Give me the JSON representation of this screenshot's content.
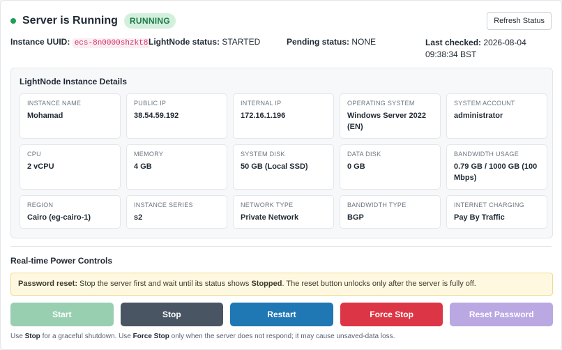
{
  "header": {
    "title": "Server is Running",
    "badge": "RUNNING",
    "refresh_label": "Refresh Status"
  },
  "info": {
    "uuid_label": "Instance UUID:",
    "uuid_value": "ecs-8n0000shzkt8",
    "lightnode_label": "LightNode status:",
    "lightnode_value": "STARTED",
    "pending_label": "Pending status:",
    "pending_value": "NONE",
    "checked_label": "Last checked:",
    "checked_value": "2026-08-04 09:38:34 BST"
  },
  "details": {
    "title": "LightNode Instance Details",
    "tiles": [
      {
        "label": "INSTANCE NAME",
        "value": "Mohamad"
      },
      {
        "label": "PUBLIC IP",
        "value": "38.54.59.192"
      },
      {
        "label": "INTERNAL IP",
        "value": "172.16.1.196"
      },
      {
        "label": "OPERATING SYSTEM",
        "value": "Windows Server 2022 (EN)"
      },
      {
        "label": "SYSTEM ACCOUNT",
        "value": "administrator"
      },
      {
        "label": "CPU",
        "value": "2 vCPU"
      },
      {
        "label": "MEMORY",
        "value": "4 GB"
      },
      {
        "label": "SYSTEM DISK",
        "value": "50 GB (Local SSD)"
      },
      {
        "label": "DATA DISK",
        "value": "0 GB"
      },
      {
        "label": "BANDWIDTH USAGE",
        "value": "0.79 GB / 1000 GB (100 Mbps)"
      },
      {
        "label": "REGION",
        "value": "Cairo (eg-cairo-1)"
      },
      {
        "label": "INSTANCE SERIES",
        "value": "s2"
      },
      {
        "label": "NETWORK TYPE",
        "value": "Private Network"
      },
      {
        "label": "BANDWIDTH TYPE",
        "value": "BGP"
      },
      {
        "label": "INTERNET CHARGING",
        "value": "Pay By Traffic"
      }
    ]
  },
  "controls": {
    "title": "Real-time Power Controls",
    "alert_lead": "Password reset:",
    "alert_text_1": "Stop the server first and wait until its status shows",
    "alert_strong": "Stopped",
    "alert_text_2": ". The reset button unlocks only after the server is fully off.",
    "buttons": {
      "start": "Start",
      "stop": "Stop",
      "restart": "Restart",
      "force_stop": "Force Stop",
      "reset_password": "Reset Password"
    },
    "footnote_1": "Use",
    "footnote_stop": "Stop",
    "footnote_2": "for a graceful shutdown. Use",
    "footnote_force": "Force Stop",
    "footnote_3": "only when the server does not respond; it may cause unsaved-data loss."
  },
  "colors": {
    "running_dot": "#1e9e5a",
    "start": "#98cfb1",
    "stop": "#4a5563",
    "restart": "#1f77b4",
    "force_stop": "#dc3545",
    "reset_password": "#b9a8e2"
  }
}
